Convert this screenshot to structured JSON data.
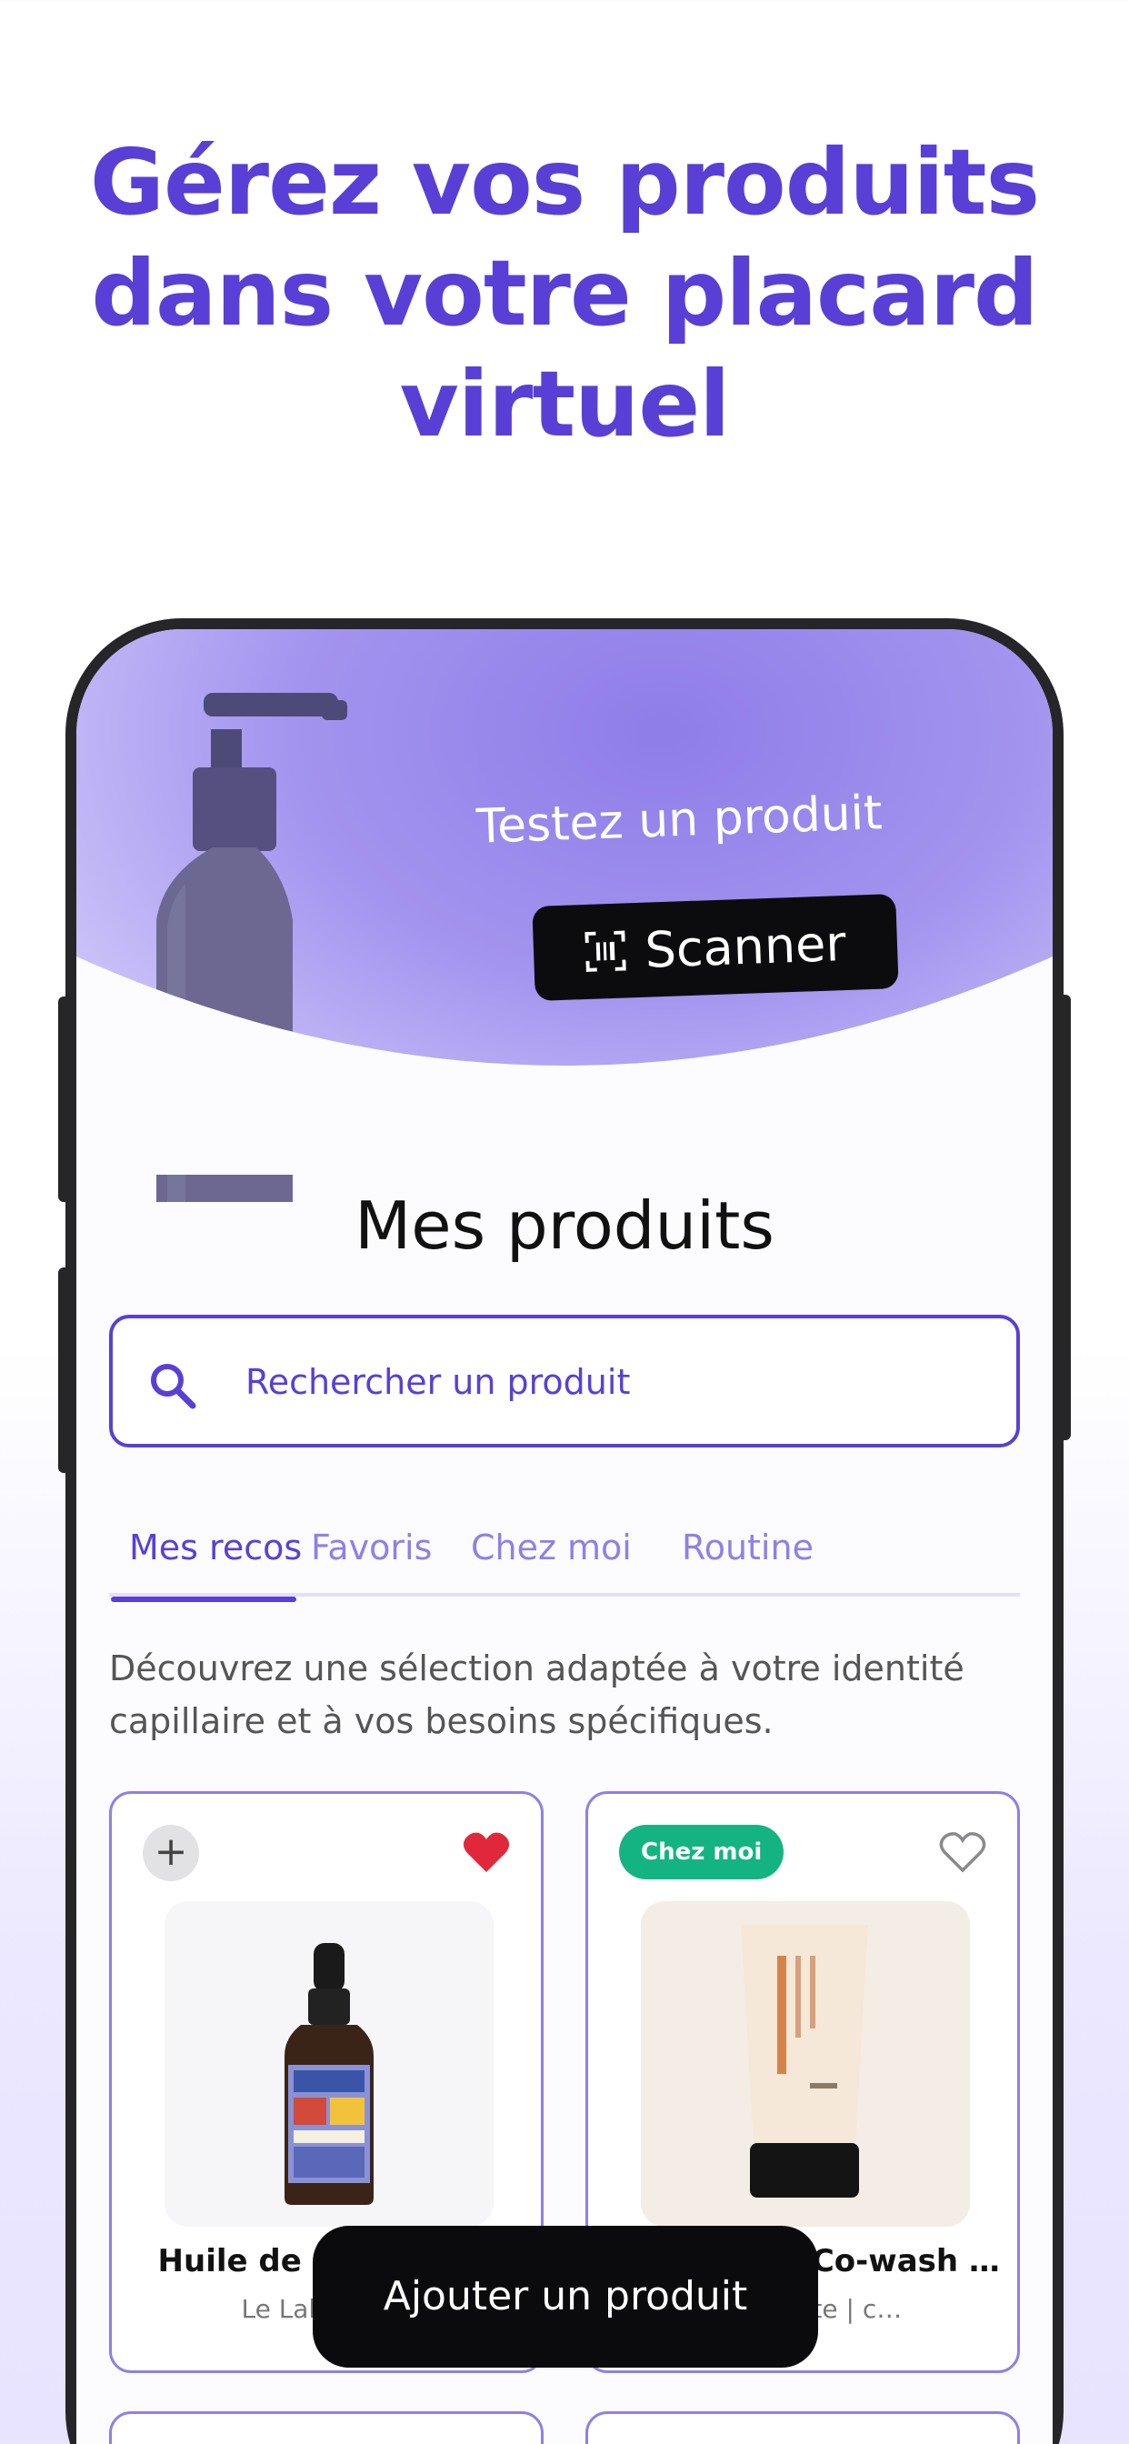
{
  "headline": {
    "line1": "Gérez vos produits",
    "line2": "dans votre placard",
    "line3": "virtuel"
  },
  "hero": {
    "tagline": "Testez un produit",
    "scan_label": "Scanner"
  },
  "main": {
    "title": "Mes produits",
    "search_placeholder": "Rechercher un produit",
    "tabs": [
      {
        "label": "Mes recos",
        "active": true
      },
      {
        "label": "Favoris",
        "active": false
      },
      {
        "label": "Chez moi",
        "active": false
      },
      {
        "label": "Routine",
        "active": false
      }
    ],
    "description": "Découvrez une sélection adaptée à votre identité capillaire et à vos besoins spécifiques."
  },
  "products": [
    {
      "name": "Huile de nigelle bio",
      "brand": "Le Labo Shay",
      "favorite": true,
      "badge": ""
    },
    {
      "name": "Shampoing Co-wash …",
      "brand": "Présidente | c…",
      "favorite": false,
      "badge": "Chez moi"
    }
  ],
  "fab_label": "Ajouter un produit",
  "colors": {
    "accent": "#5a3fd6",
    "accent_light": "#8f80e6",
    "badge_green": "#14b482",
    "heart_red": "#e0283a"
  }
}
